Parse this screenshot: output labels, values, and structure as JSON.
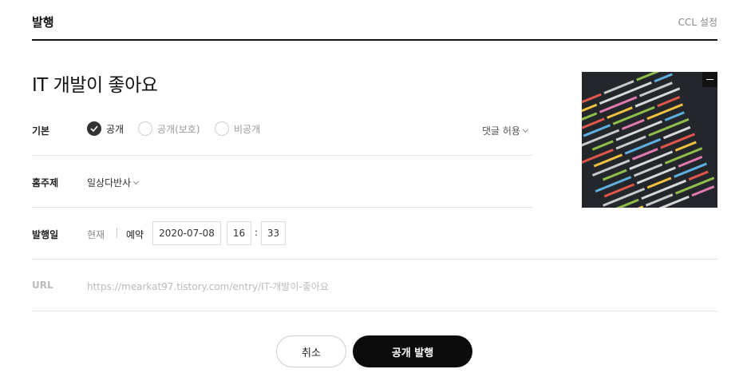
{
  "header": {
    "title": "발행",
    "ccl_label": "CCL 설정"
  },
  "post": {
    "title": "IT 개발이 좋아요"
  },
  "visibility": {
    "label": "기본",
    "options": [
      {
        "label": "공개",
        "checked": true
      },
      {
        "label": "공개(보호)",
        "checked": false
      },
      {
        "label": "비공개",
        "checked": false
      }
    ],
    "comment_label": "댓글 허용"
  },
  "topic": {
    "label": "홈주제",
    "value": "일상다반사"
  },
  "publish_date": {
    "label": "발행일",
    "now_label": "현재",
    "reserve_label": "예약",
    "date": "2020-07-08",
    "hour": "16",
    "minute": "33"
  },
  "url": {
    "label": "URL",
    "value": "https://mearkat97.tistory.com/entry/IT-개발이-좋아요"
  },
  "buttons": {
    "cancel": "취소",
    "publish": "공개 발행"
  },
  "colors": {
    "primary_button": "#0b0b0b",
    "divider": "#e6e6e6"
  }
}
